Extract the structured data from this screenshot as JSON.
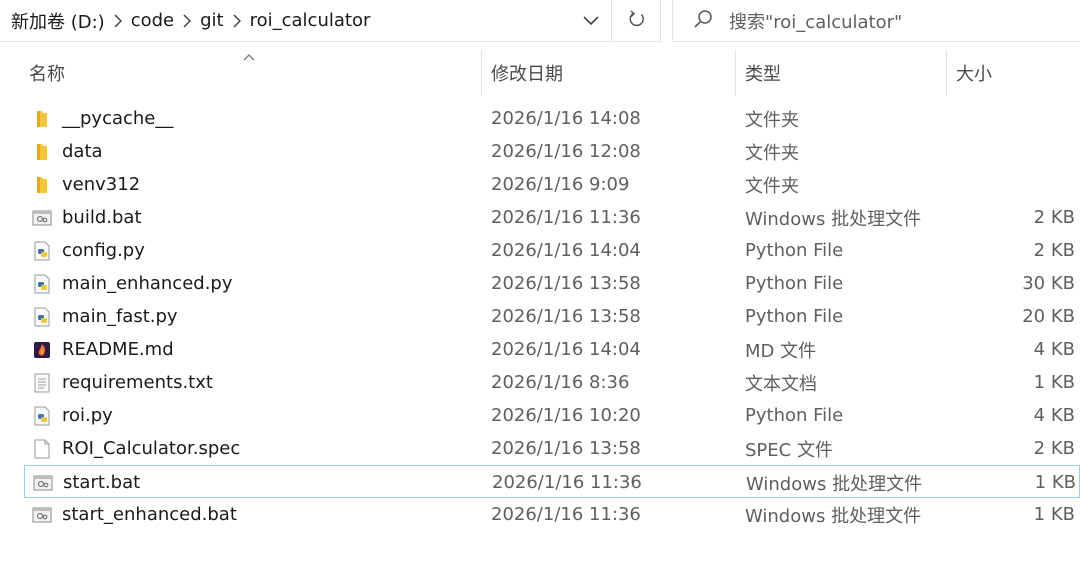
{
  "address_bar": {
    "breadcrumbs": [
      "新加卷 (D:)",
      "code",
      "git",
      "roi_calculator"
    ]
  },
  "search": {
    "placeholder": "搜索\"roi_calculator\""
  },
  "columns": {
    "name": "名称",
    "date": "修改日期",
    "type": "类型",
    "size": "大小"
  },
  "files": [
    {
      "name": "__pycache__",
      "date": "2026/1/16 14:08",
      "type": "文件夹",
      "size": "",
      "icon": "folder-icon"
    },
    {
      "name": "data",
      "date": "2026/1/16 12:08",
      "type": "文件夹",
      "size": "",
      "icon": "folder-icon"
    },
    {
      "name": "venv312",
      "date": "2026/1/16 9:09",
      "type": "文件夹",
      "size": "",
      "icon": "folder-icon"
    },
    {
      "name": "build.bat",
      "date": "2026/1/16 11:36",
      "type": "Windows 批处理文件",
      "size": "2 KB",
      "icon": "batch-file-icon"
    },
    {
      "name": "config.py",
      "date": "2026/1/16 14:04",
      "type": "Python File",
      "size": "2 KB",
      "icon": "python-file-icon"
    },
    {
      "name": "main_enhanced.py",
      "date": "2026/1/16 13:58",
      "type": "Python File",
      "size": "30 KB",
      "icon": "python-file-icon"
    },
    {
      "name": "main_fast.py",
      "date": "2026/1/16 13:58",
      "type": "Python File",
      "size": "20 KB",
      "icon": "python-file-icon"
    },
    {
      "name": "README.md",
      "date": "2026/1/16 14:04",
      "type": "MD 文件",
      "size": "4 KB",
      "icon": "markdown-file-icon"
    },
    {
      "name": "requirements.txt",
      "date": "2026/1/16 8:36",
      "type": "文本文档",
      "size": "1 KB",
      "icon": "text-file-icon"
    },
    {
      "name": "roi.py",
      "date": "2026/1/16 10:20",
      "type": "Python File",
      "size": "4 KB",
      "icon": "python-file-icon"
    },
    {
      "name": "ROI_Calculator.spec",
      "date": "2026/1/16 13:58",
      "type": "SPEC 文件",
      "size": "2 KB",
      "icon": "blank-file-icon"
    },
    {
      "name": "start.bat",
      "date": "2026/1/16 11:36",
      "type": "Windows 批处理文件",
      "size": "1 KB",
      "icon": "batch-file-icon"
    },
    {
      "name": "start_enhanced.bat",
      "date": "2026/1/16 11:36",
      "type": "Windows 批处理文件",
      "size": "1 KB",
      "icon": "batch-file-icon"
    }
  ],
  "colors": {
    "folder": "#f8c43a",
    "selection_border": "#9cd0ef",
    "secondary_text": "#5f5f5f"
  }
}
